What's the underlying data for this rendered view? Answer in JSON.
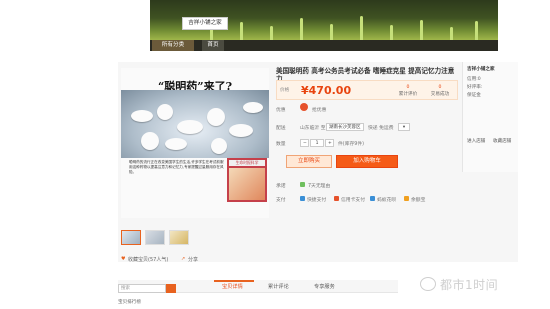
{
  "shop": {
    "name": "吉祥小铺之家"
  },
  "nav": {
    "all_categories": "所有分类",
    "home": "首页"
  },
  "product": {
    "title": "美国聪明药 高考公务员考试必备 嗜睡症克星 提高记忆力注意力",
    "image_headline": "“聪明药”来了?",
    "image_caption": "聪明药的流行正在改变美国学生的生活,许多学生在考试前服用这种药物以提高注意力和记忆力,专家提醒过量服用存在风险。",
    "magazine_title": "生命时报科学",
    "price_label": "价格",
    "price": "¥470.00",
    "stats": [
      {
        "value": "0",
        "label": "累计评价"
      },
      {
        "value": "0",
        "label": "交易成功"
      }
    ],
    "promo_label": "优惠",
    "promo_text": "抢优惠",
    "ship_label": "配送",
    "ship_from": "山东临沂 至",
    "ship_to": "湖南长沙芙蓉区",
    "ship_fee": "快递 免运费",
    "qty_label": "数量",
    "qty_minus": "−",
    "qty_value": "1",
    "qty_plus": "+",
    "stock": "件(库存9件)",
    "buy_button": "立即购买",
    "cart_button": "加入购物车",
    "service_label": "承诺",
    "service_text": "7天无理由",
    "pay_label": "支付",
    "pay_methods": [
      "快捷支付",
      "信用卡支付",
      "蚂蚁花呗",
      "余额宝"
    ],
    "favorite": "收藏宝贝(57人气)",
    "share": "分享"
  },
  "seller": {
    "shop_name": "吉祥小铺之家",
    "credit": "信用:0",
    "rate": "好评率:",
    "deposit": "保证金",
    "enter_shop": "进入店铺",
    "favorite_shop": "收藏店铺"
  },
  "bottom": {
    "search_placeholder": "搜索",
    "tabs": [
      "宝贝详情",
      "累计评论",
      "专享服务"
    ],
    "sidebar_label": "宝贝排行榜"
  },
  "watermark": {
    "text": "都市1时间"
  },
  "colors": {
    "accent": "#e8440f",
    "cart": "#f55b17"
  }
}
